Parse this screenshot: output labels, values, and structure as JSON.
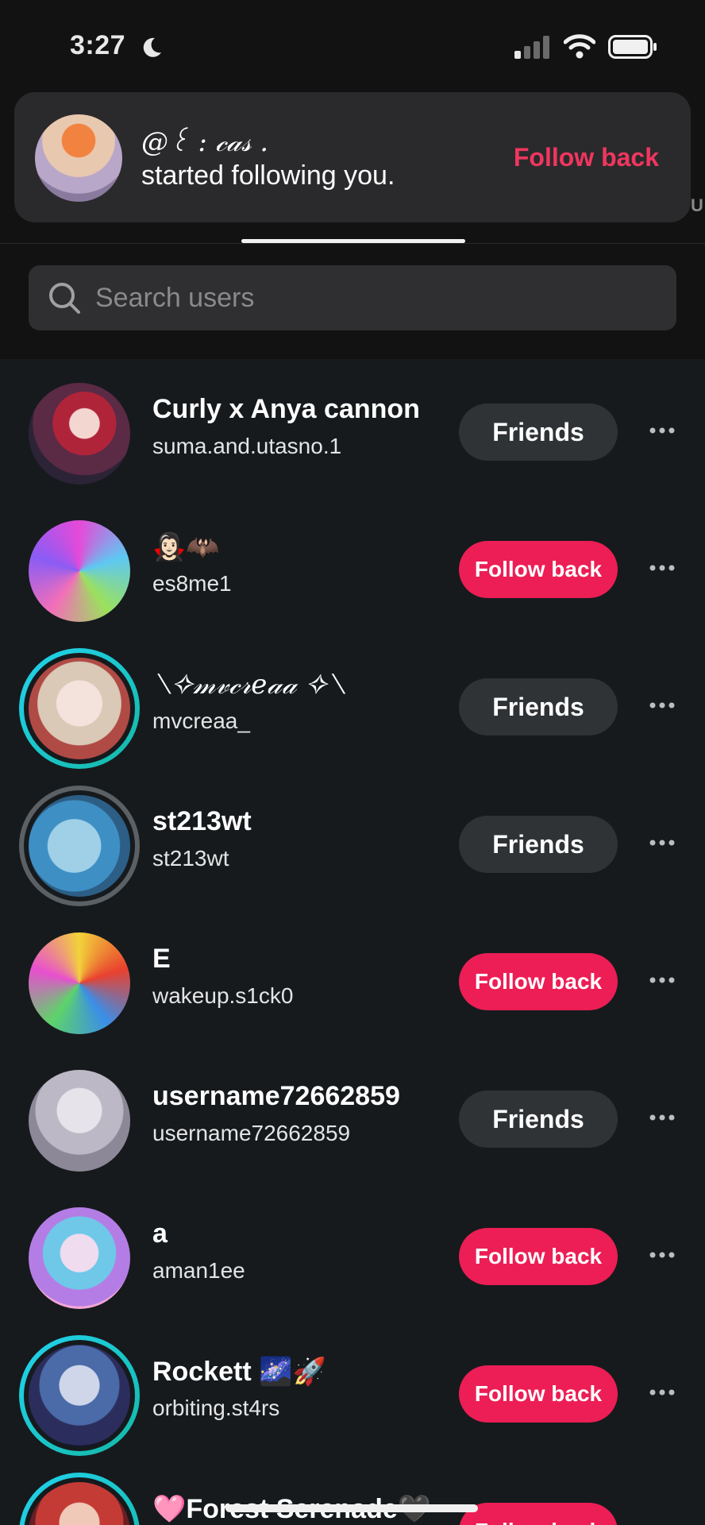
{
  "status_bar": {
    "time": "3:27"
  },
  "notification": {
    "name": "@꒰ : 𝒸𝒶𝓈 .",
    "text": "started following you.",
    "action_label": "Follow back"
  },
  "edge_letter": "U",
  "search": {
    "placeholder": "Search users"
  },
  "rows": [
    {
      "name": "Curly x Anya cannon",
      "handle": "suma.and.utasno.1",
      "button": "Friends"
    },
    {
      "name": "🧛🏻‍♀️🦇",
      "handle": "es8me1",
      "button": "Follow back"
    },
    {
      "name": "⟍✧𝓂𝓋𝒸𝓇𝑒𝒶𝒶 ✧⟍",
      "handle": "mvcreaa_",
      "button": "Friends"
    },
    {
      "name": "st213wt",
      "handle": "st213wt",
      "button": "Friends"
    },
    {
      "name": "E",
      "handle": "wakeup.s1ck0",
      "button": "Follow back"
    },
    {
      "name": "username72662859",
      "handle": "username72662859",
      "button": "Friends"
    },
    {
      "name": "a",
      "handle": "aman1ee",
      "button": "Follow back"
    },
    {
      "name": "Rockett 🌌🚀",
      "handle": "orbiting.st4rs",
      "button": "Follow back"
    },
    {
      "name": "🩷Forest Serenade🖤",
      "handle": "",
      "button": "Follow back"
    }
  ],
  "colors": {
    "accent": "#ec1e55",
    "friends_button": "#2f3336",
    "background": "#161a1d"
  }
}
